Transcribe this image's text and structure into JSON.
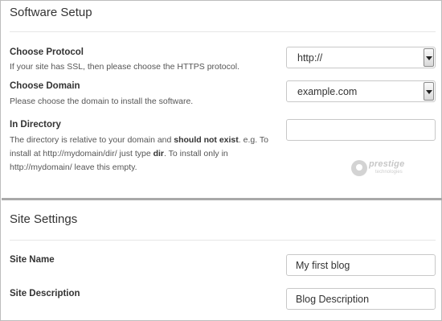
{
  "software_setup": {
    "title": "Software Setup",
    "protocol": {
      "label": "Choose Protocol",
      "help": "If your site has SSL, then please choose the HTTPS protocol.",
      "value": "http://"
    },
    "domain": {
      "label": "Choose Domain",
      "help": "Please choose the domain to install the software.",
      "value": "example.com"
    },
    "directory": {
      "label": "In Directory",
      "help_part1": "The directory is relative to your domain and ",
      "help_bold1": "should not exist",
      "help_part2": ". e.g. To install at http://mydomain/dir/ just type ",
      "help_bold2": "dir",
      "help_part3": ". To install only in http://mydomain/ leave this empty.",
      "value": ""
    },
    "watermark": {
      "word": "prestige",
      "sub": "technologies"
    }
  },
  "site_settings": {
    "title": "Site Settings",
    "site_name": {
      "label": "Site Name",
      "value": "My first blog"
    },
    "site_description": {
      "label": "Site Description",
      "value": "Blog Description"
    }
  }
}
